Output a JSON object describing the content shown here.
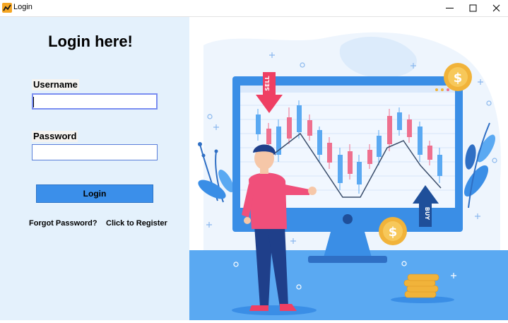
{
  "window": {
    "title": "Login",
    "icon": "app-logo-icon",
    "controls": [
      "minimize-icon",
      "maximize-icon",
      "close-icon"
    ]
  },
  "login": {
    "heading": "Login here!",
    "username_label": "Username",
    "username_value": "",
    "password_label": "Password",
    "password_value": "",
    "login_button": "Login",
    "forgot_link": "Forgot Password?",
    "register_link": "Click to Register"
  },
  "illustration": {
    "sell_tag": "SELL",
    "buy_tag": "BUY",
    "coin_symbol": "$"
  },
  "colors": {
    "left_panel_bg": "#e4f1fc",
    "button_blue": "#3b8fea",
    "field_border": "#5a7fd9",
    "candle_red": "#ef6f8e",
    "candle_blue": "#5aa9f2",
    "monitor_blue": "#3a8ee6"
  }
}
